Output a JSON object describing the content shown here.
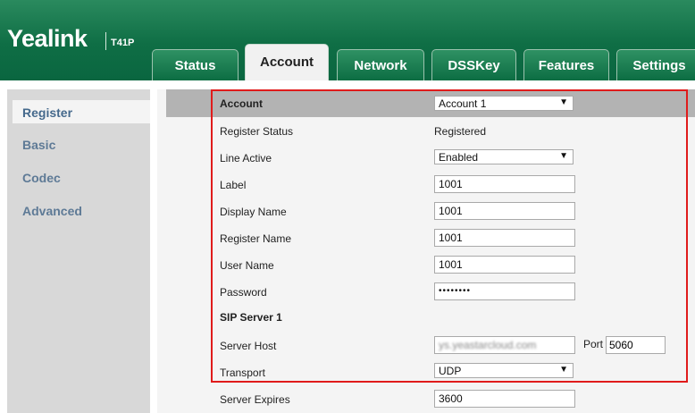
{
  "header": {
    "brand": "Yealink",
    "model": "T41P"
  },
  "tabs": [
    "Status",
    "Account",
    "Network",
    "DSSKey",
    "Features",
    "Settings"
  ],
  "sidebar": [
    "Register",
    "Basic",
    "Codec",
    "Advanced"
  ],
  "form": {
    "account": {
      "label": "Account",
      "value": "Account 1"
    },
    "register_status": {
      "label": "Register Status",
      "value": "Registered"
    },
    "line_active": {
      "label": "Line Active",
      "value": "Enabled"
    },
    "label": {
      "label": "Label",
      "value": "1001"
    },
    "display_name": {
      "label": "Display Name",
      "value": "1001"
    },
    "register_name": {
      "label": "Register Name",
      "value": "1001"
    },
    "user_name": {
      "label": "User Name",
      "value": "1001"
    },
    "password": {
      "label": "Password",
      "value": "••••••••"
    },
    "sip_server_heading": "SIP Server 1",
    "server_host": {
      "label": "Server Host",
      "value": "ys.yeastarcloud.com",
      "port_label": "Port",
      "port": "5060"
    },
    "transport": {
      "label": "Transport",
      "value": "UDP"
    },
    "server_expires": {
      "label": "Server Expires",
      "value": "3600"
    }
  },
  "colors": {
    "header_green": "#0f6e45",
    "highlight_red": "#e01b1b",
    "sidebar_text": "#5e7a96"
  }
}
